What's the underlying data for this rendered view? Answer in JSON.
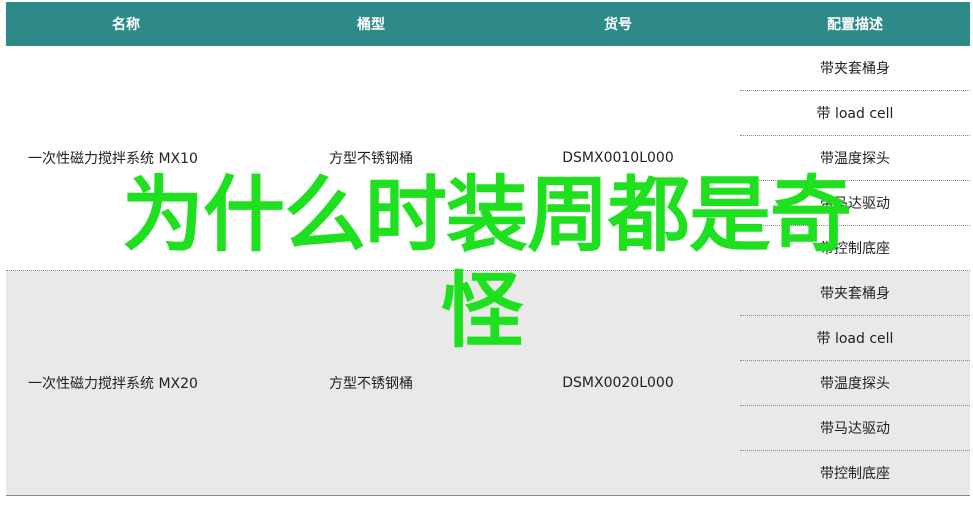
{
  "table": {
    "headers": [
      "名称",
      "桶型",
      "货号",
      "配置描述"
    ],
    "products": [
      {
        "name": "一次性磁力搅拌系统 MX10",
        "bucket": "方型不锈钢桶",
        "sku": "DSMX0010L000",
        "configs": [
          "带夹套桶身",
          "带 load cell",
          "带温度探头",
          "带马达驱动",
          "带控制底座"
        ]
      },
      {
        "name": "一次性磁力搅拌系统 MX20",
        "bucket": "方型不锈钢桶",
        "sku": "DSMX0020L000",
        "configs": [
          "带夹套桶身",
          "带 load cell",
          "带温度探头",
          "带马达驱动",
          "带控制底座"
        ]
      }
    ]
  },
  "overlay": {
    "line1": "为什么时装周都是奇",
    "line2": "怪"
  },
  "colors": {
    "header_bg": "#2e8a88",
    "overlay_text": "#1fe01f",
    "alt_row_bg": "#e9e9e9"
  }
}
